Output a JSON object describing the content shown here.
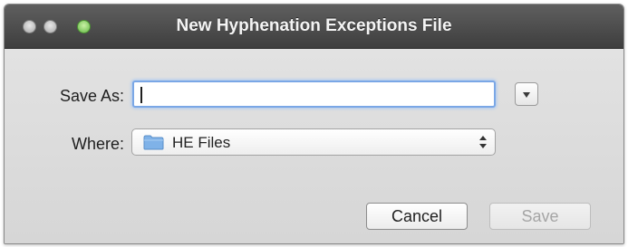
{
  "window": {
    "title": "New Hyphenation Exceptions File",
    "controls": [
      "close",
      "minimize",
      "zoom"
    ]
  },
  "form": {
    "save_as_label": "Save As:",
    "save_as_value": "",
    "expand_icon": "disclosure-triangle-icon",
    "where_label": "Where:",
    "where_value": "HE Files",
    "where_icon": "folder-icon"
  },
  "buttons": {
    "cancel_label": "Cancel",
    "save_label": "Save",
    "save_enabled": false
  },
  "colors": {
    "titlebar": "#4a4a4a",
    "focus_ring": "#7aa7e6",
    "folder": "#7fb2e8",
    "zoom_button": "#63b844"
  }
}
